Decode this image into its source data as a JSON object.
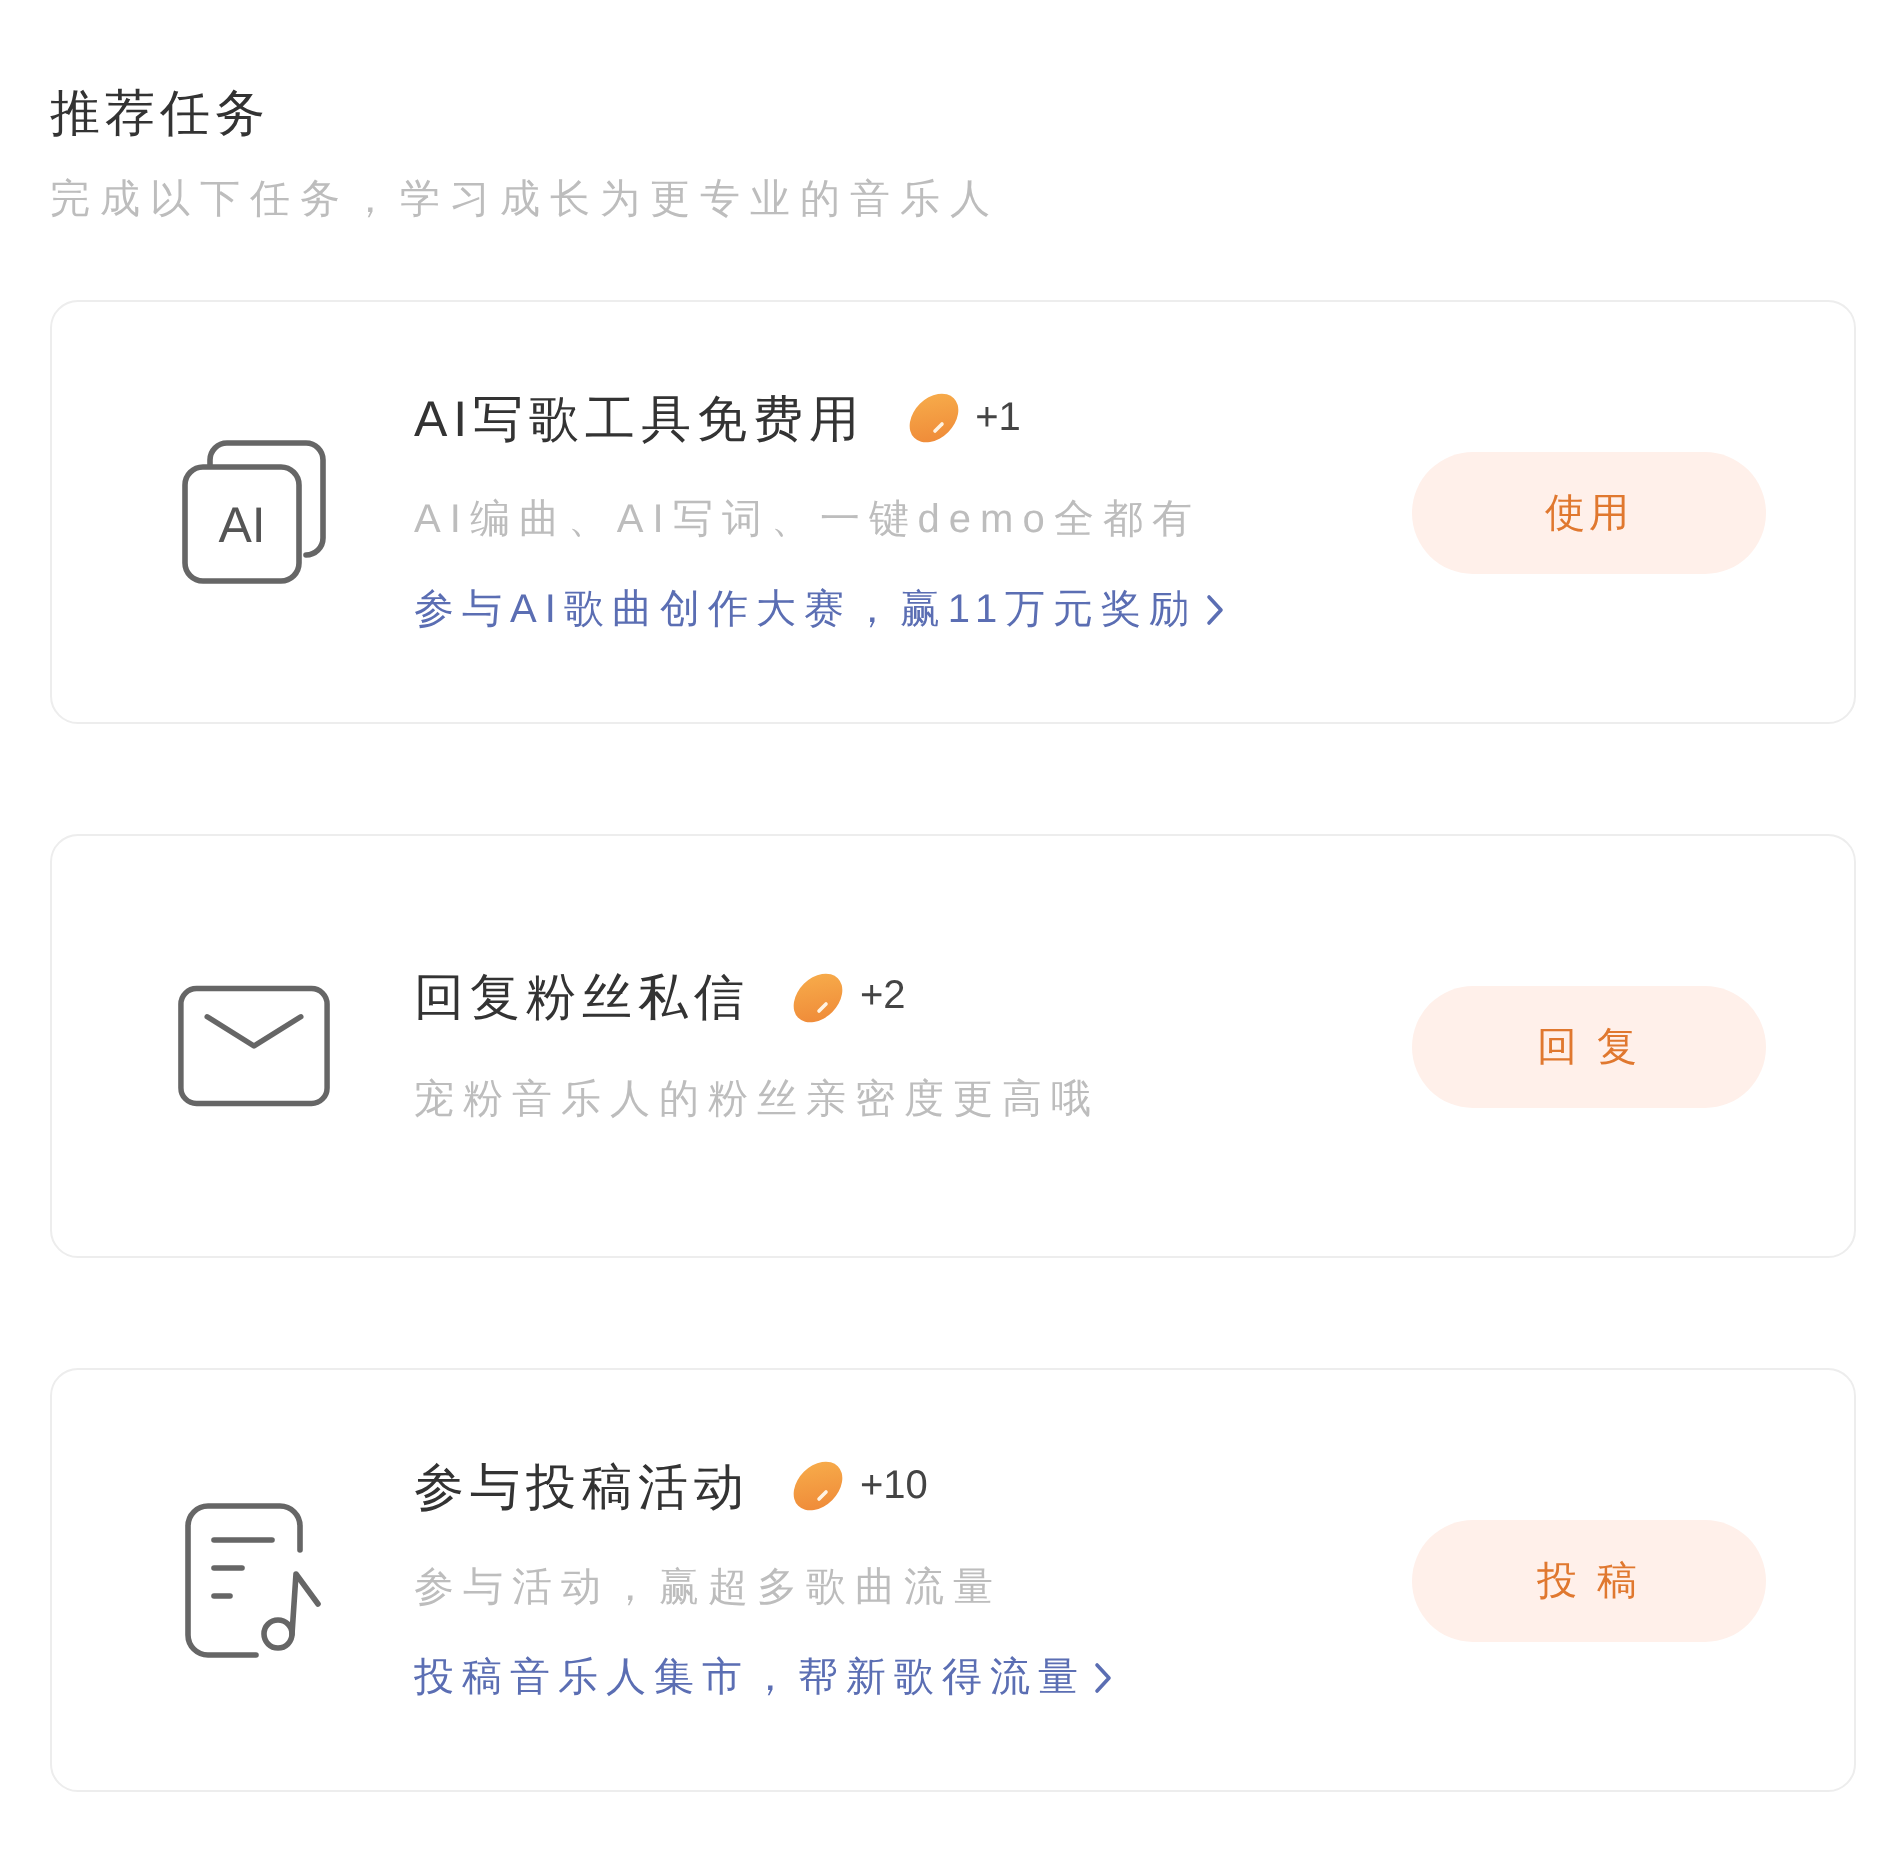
{
  "header": {
    "title": "推荐任务",
    "subtitle": "完成以下任务，学习成长为更专业的音乐人"
  },
  "tasks": [
    {
      "kind": "ai",
      "icon_text": "AI",
      "title": "AI写歌工具免费用",
      "reward": "+1",
      "description": "AI编曲、AI写词、一键demo全都有",
      "link": "参与AI歌曲创作大赛，赢11万元奖励",
      "button": "使用"
    },
    {
      "kind": "reply",
      "title": "回复粉丝私信",
      "reward": "+2",
      "description": "宠粉音乐人的粉丝亲密度更高哦",
      "button": "回 复"
    },
    {
      "kind": "submit",
      "title": "参与投稿活动",
      "reward": "+10",
      "description": "参与活动，赢超多歌曲流量",
      "link": "投稿音乐人集市，帮新歌得流量",
      "button": "投 稿"
    }
  ]
}
